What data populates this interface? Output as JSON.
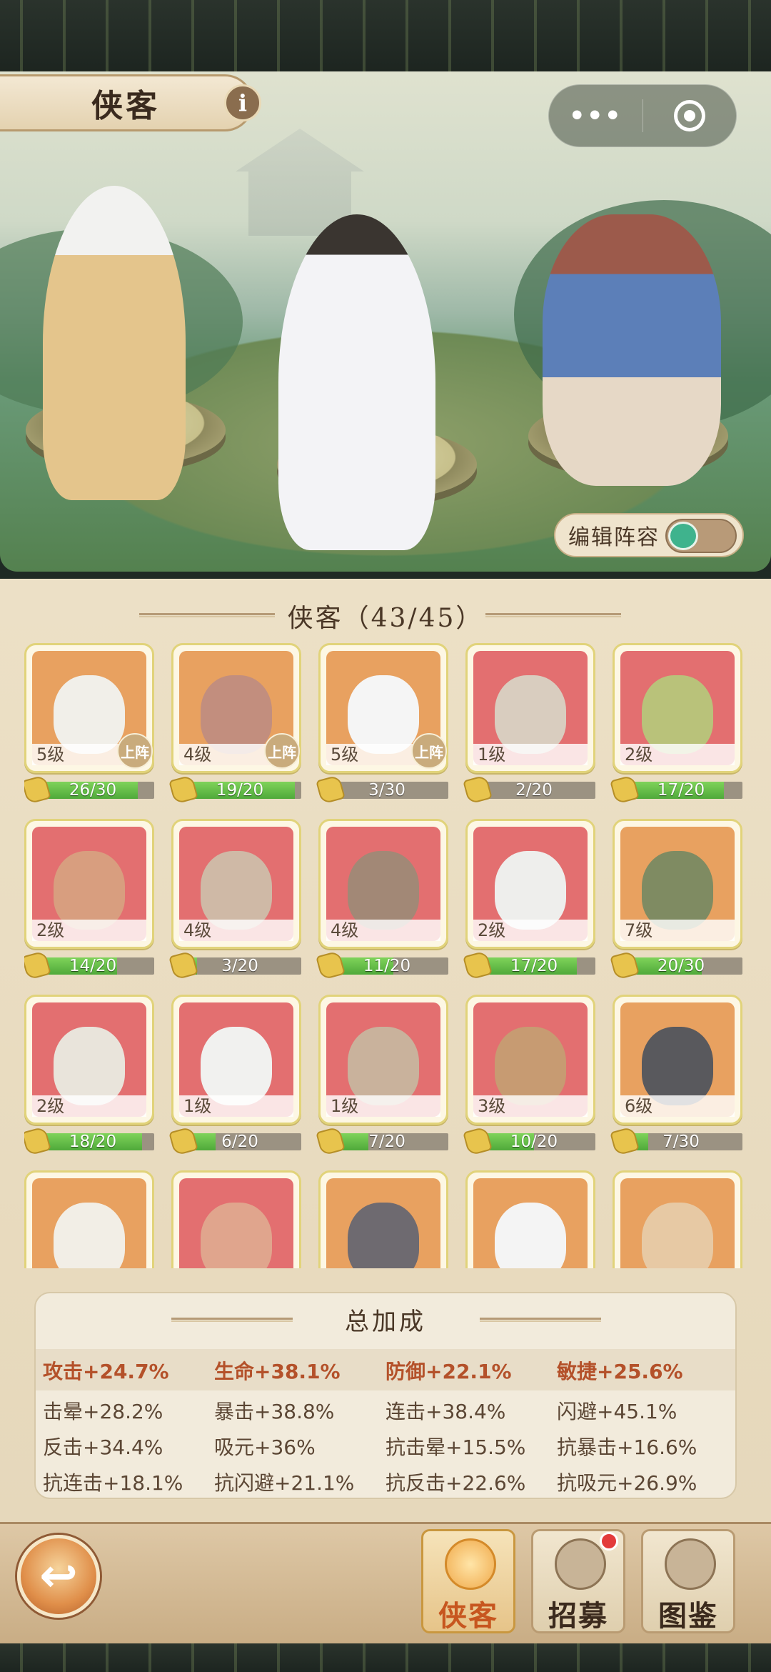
{
  "header": {
    "title": "侠客",
    "info_icon": "i"
  },
  "capsule": {
    "menu": "•••"
  },
  "scene": {
    "edit_lineup_label": "编辑阵容",
    "edit_lineup_toggle": true
  },
  "roster": {
    "title": "侠客（43/45）",
    "heroes": [
      {
        "level": "5级",
        "progress": "26/30",
        "fraction": 0.867,
        "promote": "上阵",
        "bg": "#e8a160",
        "face": "#f1efe9"
      },
      {
        "level": "4级",
        "progress": "19/20",
        "fraction": 0.95,
        "promote": "上阵",
        "bg": "#e8a160",
        "face": "#c28e7e"
      },
      {
        "level": "5级",
        "progress": "3/30",
        "fraction": 0.1,
        "promote": "上阵",
        "bg": "#e8a160",
        "face": "#f5f5f5"
      },
      {
        "level": "1级",
        "progress": "2/20",
        "fraction": 0.1,
        "promote": "",
        "bg": "#e36f70",
        "face": "#d9cdbf"
      },
      {
        "level": "2级",
        "progress": "17/20",
        "fraction": 0.85,
        "promote": "",
        "bg": "#e36f70",
        "face": "#b9c27a"
      },
      {
        "level": "2级",
        "progress": "14/20",
        "fraction": 0.7,
        "promote": "",
        "bg": "#e36f70",
        "face": "#d89e7f"
      },
      {
        "level": "4级",
        "progress": "3/20",
        "fraction": 0.15,
        "promote": "",
        "bg": "#e36f70",
        "face": "#cfb9a6"
      },
      {
        "level": "4级",
        "progress": "11/20",
        "fraction": 0.55,
        "promote": "",
        "bg": "#e36f70",
        "face": "#a28876"
      },
      {
        "level": "2级",
        "progress": "17/20",
        "fraction": 0.85,
        "promote": "",
        "bg": "#e36f70",
        "face": "#eeeeec"
      },
      {
        "level": "7级",
        "progress": "20/30",
        "fraction": 0.667,
        "promote": "",
        "bg": "#e8a160",
        "face": "#7f8b62"
      },
      {
        "level": "2级",
        "progress": "18/20",
        "fraction": 0.9,
        "promote": "",
        "bg": "#e36f70",
        "face": "#e9e4db"
      },
      {
        "level": "1级",
        "progress": "6/20",
        "fraction": 0.3,
        "promote": "",
        "bg": "#e36f70",
        "face": "#f1f1ef"
      },
      {
        "level": "1级",
        "progress": "7/20",
        "fraction": 0.35,
        "promote": "",
        "bg": "#e36f70",
        "face": "#c9b29c"
      },
      {
        "level": "3级",
        "progress": "10/20",
        "fraction": 0.5,
        "promote": "",
        "bg": "#e36f70",
        "face": "#c79b72"
      },
      {
        "level": "6级",
        "progress": "7/30",
        "fraction": 0.233,
        "promote": "",
        "bg": "#e8a160",
        "face": "#59595d"
      },
      {
        "level": "",
        "progress": "",
        "fraction": 0,
        "promote": "",
        "bg": "#e8a160",
        "face": "#f2eee6"
      },
      {
        "level": "",
        "progress": "",
        "fraction": 0,
        "promote": "",
        "bg": "#e36f70",
        "face": "#e0a58d"
      },
      {
        "level": "",
        "progress": "",
        "fraction": 0,
        "promote": "",
        "bg": "#e8a160",
        "face": "#6e6a70"
      },
      {
        "level": "",
        "progress": "",
        "fraction": 0,
        "promote": "",
        "bg": "#e8a160",
        "face": "#f4f4f4"
      },
      {
        "level": "",
        "progress": "",
        "fraction": 0,
        "promote": "",
        "bg": "#e8a160",
        "face": "#e7c9a4"
      }
    ]
  },
  "total_bonus": {
    "title": "总加成",
    "stats": [
      [
        "攻击+24.7%",
        "生命+38.1%",
        "防御+22.1%",
        "敏捷+25.6%"
      ],
      [
        "击晕+28.2%",
        "暴击+38.8%",
        "连击+38.4%",
        "闪避+45.1%"
      ],
      [
        "反击+34.4%",
        "吸元+36%",
        "抗击晕+15.5%",
        "抗暴击+16.6%"
      ],
      [
        "抗连击+18.1%",
        "抗闪避+21.1%",
        "抗反击+22.6%",
        "抗吸元+26.9%"
      ]
    ]
  },
  "nav": {
    "back_icon": "↩",
    "tabs": [
      {
        "label": "侠客",
        "icon": "hero-icon",
        "active": true
      },
      {
        "label": "招募",
        "icon": "recruit-icon",
        "active": false,
        "badge": true
      },
      {
        "label": "图鉴",
        "icon": "codex-icon",
        "active": false
      }
    ]
  },
  "colors": {
    "accent": "#c7561f",
    "progress_green": "#4fa93a",
    "highlight_stat": "#b4512a"
  }
}
